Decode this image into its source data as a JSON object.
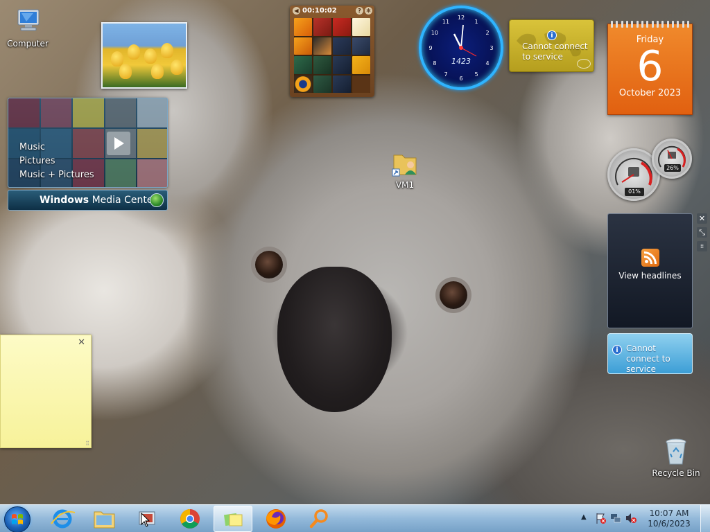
{
  "desktop": {
    "icons": {
      "computer": "Computer",
      "vm": "VM1",
      "recycle_bin": "Recycle Bin"
    }
  },
  "gadgets": {
    "puzzle": {
      "timer": "00:10:02"
    },
    "clock": {
      "digital": "1423",
      "numerals": [
        "12",
        "1",
        "2",
        "3",
        "4",
        "5",
        "6",
        "7",
        "8",
        "9",
        "10",
        "11"
      ]
    },
    "weather": {
      "message": "Cannot connect to service"
    },
    "calendar": {
      "weekday": "Friday",
      "day": "6",
      "month_year": "October 2023"
    },
    "media_center": {
      "menu": [
        "Music",
        "Pictures",
        "Music + Pictures"
      ],
      "brand_bold": "Windows",
      "brand_rest": " Media Center"
    },
    "cpu_meter": {
      "cpu": "01%",
      "memory": "26%"
    },
    "feed": {
      "label": "View headlines"
    },
    "stocks": {
      "message": "Cannot connect to service"
    }
  },
  "taskbar": {
    "time": "10:07 AM",
    "date": "10/6/2023",
    "buttons": [
      "Internet Explorer",
      "Windows Explorer",
      "Remote Desktop",
      "Google Chrome",
      "Sticky Notes",
      "Mozilla Firefox",
      "Search"
    ]
  },
  "colors": {
    "calendar": "#e8701c",
    "weather": "#c9b22a",
    "clock_ring": "#2fb4ff",
    "stocks": "#5eb3e0",
    "note": "#fbf7b0"
  }
}
